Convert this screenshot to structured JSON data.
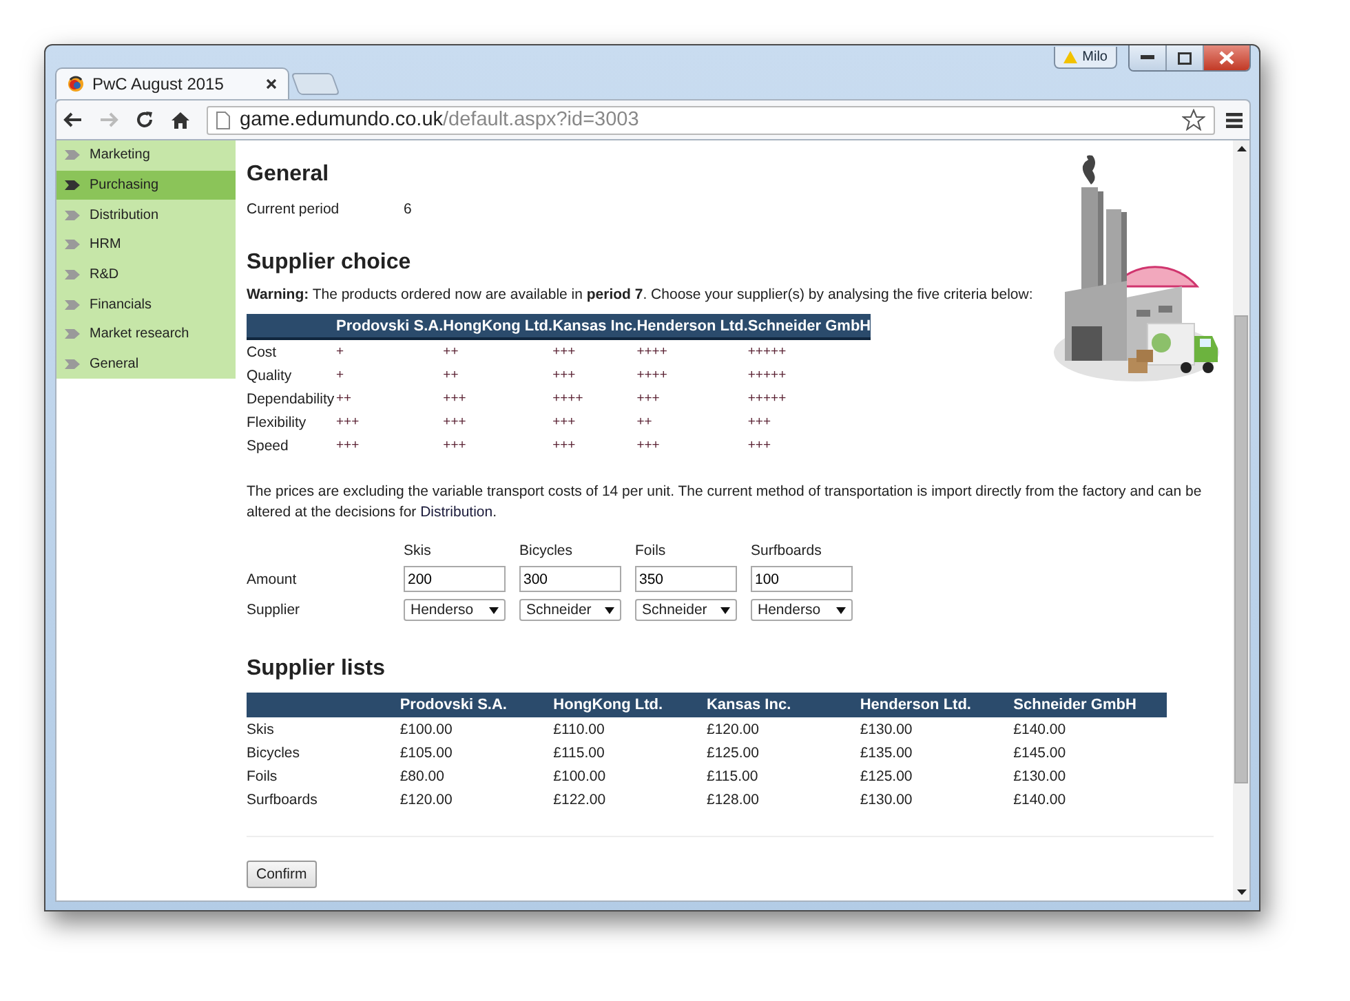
{
  "browser": {
    "tab_title": "PwC August 2015",
    "url_host": "game.edumundo.co.uk",
    "url_path": "/default.aspx?id=3003",
    "user": "Milo"
  },
  "sidebar": {
    "items": [
      {
        "label": "Marketing",
        "selected": false
      },
      {
        "label": "Purchasing",
        "selected": true
      },
      {
        "label": "Distribution",
        "selected": false
      },
      {
        "label": "HRM",
        "selected": false
      },
      {
        "label": "R&D",
        "selected": false
      },
      {
        "label": "Financials",
        "selected": false
      },
      {
        "label": "Market research",
        "selected": false
      },
      {
        "label": "General",
        "selected": false
      }
    ]
  },
  "general": {
    "heading": "General",
    "period_label": "Current period",
    "period_value": "6"
  },
  "supplier_choice": {
    "heading": "Supplier choice",
    "warning": "**Warning:** The products ordered now are available in **period 7**. Choose your supplier(s) by analysing the five criteria below:",
    "criteria_table": {
      "columns": [
        "Prodovski S.A.",
        "HongKong Ltd.",
        "Kansas Inc.",
        "Henderson Ltd.",
        "Schneider GmbH"
      ],
      "rows": [
        {
          "label": "Cost",
          "values": [
            "+",
            "++",
            "+++",
            "++++",
            "+++++"
          ]
        },
        {
          "label": "Quality",
          "values": [
            "+",
            "++",
            "+++",
            "++++",
            "+++++"
          ]
        },
        {
          "label": "Dependability",
          "values": [
            "++",
            "+++",
            "++++",
            "+++",
            "+++++"
          ]
        },
        {
          "label": "Flexibility",
          "values": [
            "+++",
            "+++",
            "+++",
            "++",
            "+++"
          ]
        },
        {
          "label": "Speed",
          "values": [
            "+++",
            "+++",
            "+++",
            "+++",
            "+++"
          ]
        }
      ]
    },
    "note": {
      "text": "The prices are excluding the variable transport costs of 14 per unit. The current method of transportation is import directly from the factory and can be altered at the decisions for",
      "link": "Distribution",
      "end": "."
    },
    "order_form": {
      "amount_label": "Amount",
      "supplier_label": "Supplier",
      "products": [
        {
          "name": "Skis",
          "amount": "200",
          "supplier": "Henderso"
        },
        {
          "name": "Bicycles",
          "amount": "300",
          "supplier": "Schneider"
        },
        {
          "name": "Foils",
          "amount": "350",
          "supplier": "Schneider"
        },
        {
          "name": "Surfboards",
          "amount": "100",
          "supplier": "Henderso"
        }
      ]
    }
  },
  "supplier_lists": {
    "heading": "Supplier lists",
    "columns": [
      "Prodovski S.A.",
      "HongKong Ltd.",
      "Kansas Inc.",
      "Henderson Ltd.",
      "Schneider GmbH"
    ],
    "rows": [
      {
        "label": "Skis",
        "prices": [
          "£100.00",
          "£110.00",
          "£120.00",
          "£130.00",
          "£140.00"
        ]
      },
      {
        "label": "Bicycles",
        "prices": [
          "£105.00",
          "£115.00",
          "£125.00",
          "£135.00",
          "£145.00"
        ]
      },
      {
        "label": "Foils",
        "prices": [
          "£80.00",
          "£100.00",
          "£115.00",
          "£125.00",
          "£130.00"
        ]
      },
      {
        "label": "Surfboards",
        "prices": [
          "£120.00",
          "£122.00",
          "£128.00",
          "£130.00",
          "£140.00"
        ]
      }
    ]
  },
  "confirm_button": "Confirm"
}
